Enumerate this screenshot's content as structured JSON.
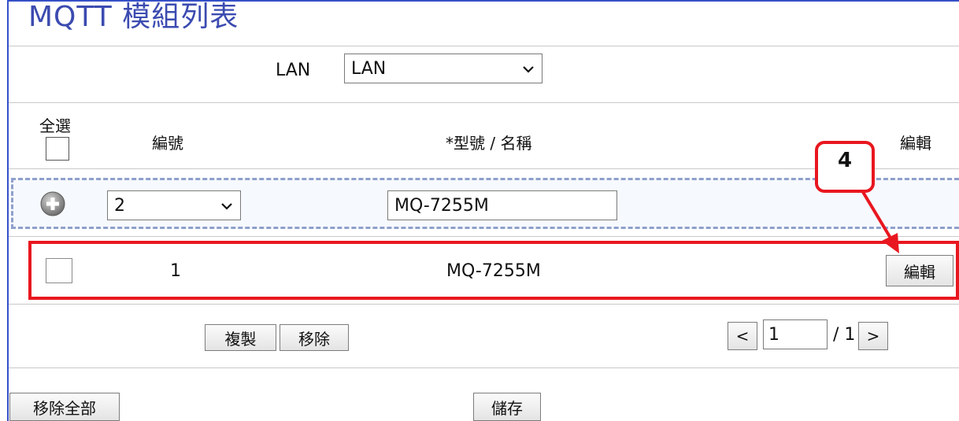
{
  "page": {
    "title": "MQTT 模組列表"
  },
  "lan": {
    "label": "LAN",
    "selected": "LAN"
  },
  "table": {
    "headers": {
      "select_all": "全選",
      "number": "編號",
      "model_name": "*型號 / 名稱",
      "edit": "編輯"
    },
    "new_row": {
      "number_selected": "2",
      "name_value": "MQ-7255M"
    },
    "rows": [
      {
        "number": "1",
        "name": "MQ-7255M",
        "edit_label": "編輯"
      }
    ]
  },
  "actions": {
    "copy_label": "複製",
    "remove_label": "移除",
    "remove_all_label": "移除全部",
    "save_label": "儲存"
  },
  "pagination": {
    "prev_label": "<",
    "current_page": "1",
    "total": "/ 1",
    "next_label": ">"
  },
  "annotation": {
    "step_number": "4",
    "color": "#e8171f"
  }
}
